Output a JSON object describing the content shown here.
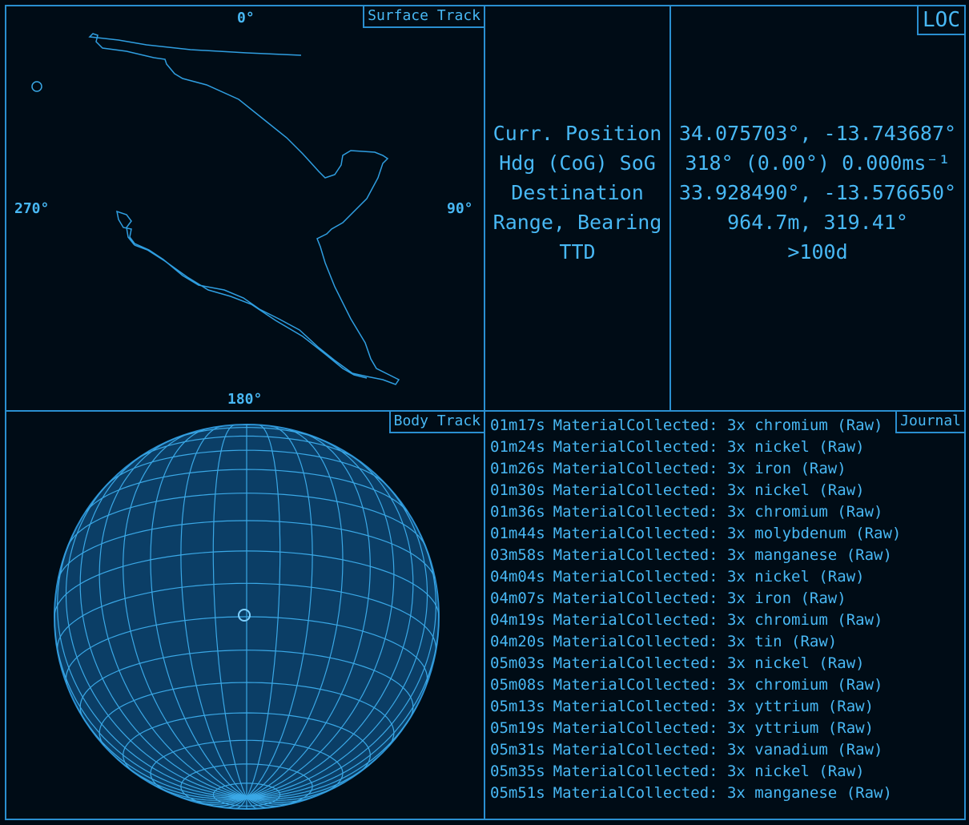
{
  "surface_track": {
    "title": "Surface Track",
    "compass": {
      "north": "0°",
      "east": "90°",
      "south": "180°",
      "west": "270°"
    }
  },
  "loc": {
    "title": "LOC",
    "labels": [
      "Curr. Position",
      "Hdg (CoG) SoG",
      "Destination",
      "Range, Bearing",
      "TTD"
    ],
    "values": [
      "34.075703°, -13.743687°",
      "318° (0.00°) 0.000ms⁻¹",
      "33.928490°, -13.576650°",
      "964.7m, 319.41°",
      ">100d"
    ]
  },
  "body_track": {
    "title": "Body Track"
  },
  "journal": {
    "title": "Journal",
    "entries": [
      {
        "time": "01m17s",
        "text": "MaterialCollected: 3x chromium (Raw)"
      },
      {
        "time": "01m24s",
        "text": "MaterialCollected: 3x nickel (Raw)"
      },
      {
        "time": "01m26s",
        "text": "MaterialCollected: 3x iron (Raw)"
      },
      {
        "time": "01m30s",
        "text": "MaterialCollected: 3x nickel (Raw)"
      },
      {
        "time": "01m36s",
        "text": "MaterialCollected: 3x chromium (Raw)"
      },
      {
        "time": "01m44s",
        "text": "MaterialCollected: 3x molybdenum (Raw)"
      },
      {
        "time": "03m58s",
        "text": "MaterialCollected: 3x manganese (Raw)"
      },
      {
        "time": "04m04s",
        "text": "MaterialCollected: 3x nickel (Raw)"
      },
      {
        "time": "04m07s",
        "text": "MaterialCollected: 3x iron (Raw)"
      },
      {
        "time": "04m19s",
        "text": "MaterialCollected: 3x chromium (Raw)"
      },
      {
        "time": "04m20s",
        "text": "MaterialCollected: 3x tin (Raw)"
      },
      {
        "time": "05m03s",
        "text": "MaterialCollected: 3x nickel (Raw)"
      },
      {
        "time": "05m08s",
        "text": "MaterialCollected: 3x chromium (Raw)"
      },
      {
        "time": "05m13s",
        "text": "MaterialCollected: 3x yttrium (Raw)"
      },
      {
        "time": "05m19s",
        "text": "MaterialCollected: 3x yttrium (Raw)"
      },
      {
        "time": "05m31s",
        "text": "MaterialCollected: 3x vanadium (Raw)"
      },
      {
        "time": "05m35s",
        "text": "MaterialCollected: 3x nickel (Raw)"
      },
      {
        "time": "05m51s",
        "text": "MaterialCollected: 3x manganese (Raw)"
      }
    ]
  },
  "colors": {
    "accent": "#2a8fd0",
    "text": "#48b8f4",
    "background": "#000c16",
    "globe_fill": "#0b3e66"
  }
}
